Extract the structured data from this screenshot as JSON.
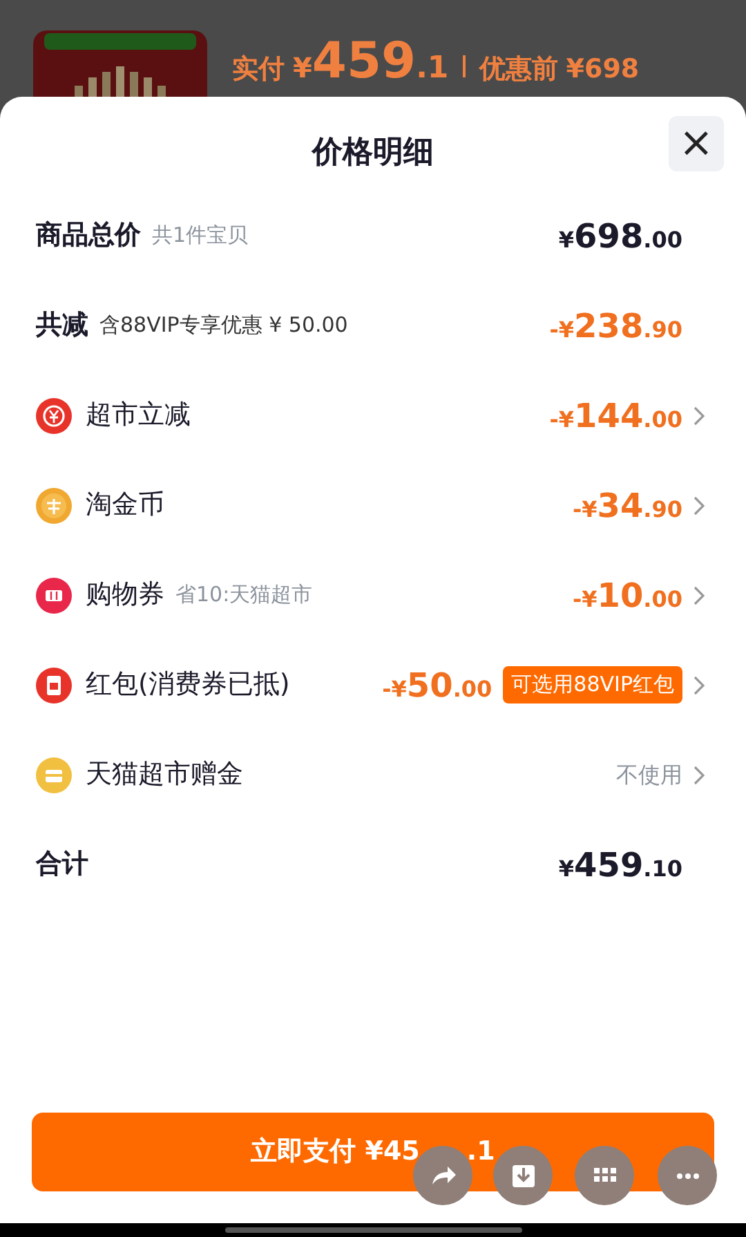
{
  "background_page": {
    "paid_label": "实付",
    "paid_currency": "¥",
    "paid_int": "459",
    "paid_dec": ".1",
    "before_label": "优惠前",
    "before_price": "¥698"
  },
  "sheet": {
    "title": "价格明细",
    "close": "×",
    "rows": [
      {
        "kind": "summary",
        "label": "商品总价",
        "note": "共1件宝贝",
        "discount": false,
        "amount": {
          "sign": "¥",
          "int": "698",
          "dec": ".00"
        },
        "chevron": false
      },
      {
        "kind": "summary",
        "label": "共减",
        "note": "含88VIP专享优惠 ¥ 50.00",
        "discount": true,
        "amount": {
          "sign": "-¥",
          "int": "238",
          "dec": ".90"
        },
        "chevron": false
      },
      {
        "kind": "item",
        "label": "超市立减",
        "discount": true,
        "amount": {
          "sign": "-¥",
          "int": "144",
          "dec": ".00"
        },
        "chevron": true
      },
      {
        "kind": "item",
        "label": "淘金币",
        "discount": true,
        "amount": {
          "sign": "-¥",
          "int": "34",
          "dec": ".90"
        },
        "chevron": true
      },
      {
        "kind": "item",
        "label": "购物券",
        "note": "省10:天猫超市",
        "discount": true,
        "amount": {
          "sign": "-¥",
          "int": "10",
          "dec": ".00"
        },
        "chevron": true
      },
      {
        "kind": "item",
        "label": "红包(消费券已抵)",
        "discount": true,
        "amount": {
          "sign": "-¥",
          "int": "50",
          "dec": ".00"
        },
        "badge": "可选用88VIP红包",
        "chevron": true
      },
      {
        "kind": "item",
        "label": "天猫超市赠金",
        "status": "不使用",
        "chevron": true
      },
      {
        "kind": "summary",
        "label": "合计",
        "discount": false,
        "amount": {
          "sign": "¥",
          "int": "459",
          "dec": ".10"
        },
        "chevron": false
      }
    ],
    "pay_button": {
      "label": "立即支付 ¥45",
      "tail": ".1"
    }
  },
  "floating_actions": [
    {
      "kind": "share"
    },
    {
      "kind": "download"
    },
    {
      "kind": "grid"
    },
    {
      "kind": "more"
    }
  ]
}
